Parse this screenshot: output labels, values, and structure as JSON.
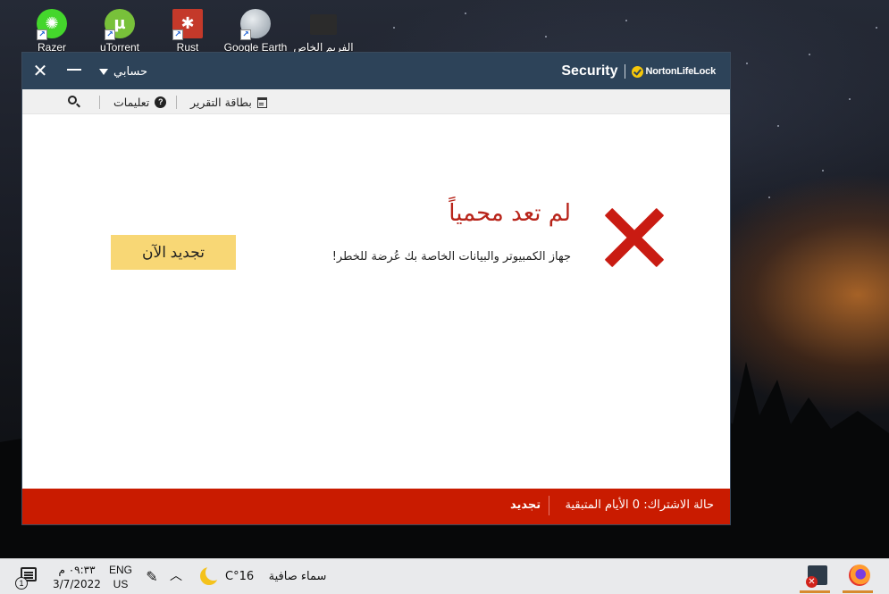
{
  "desktop": {
    "icons": [
      {
        "label": "Razer",
        "icon": "razer-icon",
        "color": "#44d62c"
      },
      {
        "label": "uTorrent",
        "icon": "utorrent-icon",
        "color": "#78c13a"
      },
      {
        "label": "Rust",
        "icon": "rust-icon",
        "color": "#c4392a"
      },
      {
        "label": "Google Earth",
        "icon": "google-earth-icon",
        "color": "#9aa6b2"
      },
      {
        "label": "الفريم الخاص",
        "icon": "video-frame-icon",
        "color": "#2b2b2b"
      }
    ]
  },
  "window": {
    "account_label": "حسابي",
    "brand_product": "Security",
    "brand_company": "NortonLifeLock",
    "toolbar": {
      "help_label": "تعليمات",
      "report_label": "بطاقة التقرير"
    },
    "status": {
      "title": "لم تعد محمياً",
      "subtitle": "جهاز الكمبيوتر والبيانات الخاصة بك عُرضة للخطر!",
      "renew_button": "تجديد الآن"
    },
    "footer": {
      "subscription_status": "حالة الاشتراك:  0 الأيام المتبقية",
      "renew_link": "تجديد"
    },
    "colors": {
      "titlebar": "#2d4359",
      "alert_red": "#c91b00",
      "button_yellow": "#f8d775"
    }
  },
  "taskbar": {
    "notification_count": "1",
    "time": "٠٩:٣٣ م",
    "date": "3/7/2022",
    "lang_line1": "ENG",
    "lang_line2": "US",
    "temperature": "16°C",
    "weather": "سماء صافية"
  }
}
